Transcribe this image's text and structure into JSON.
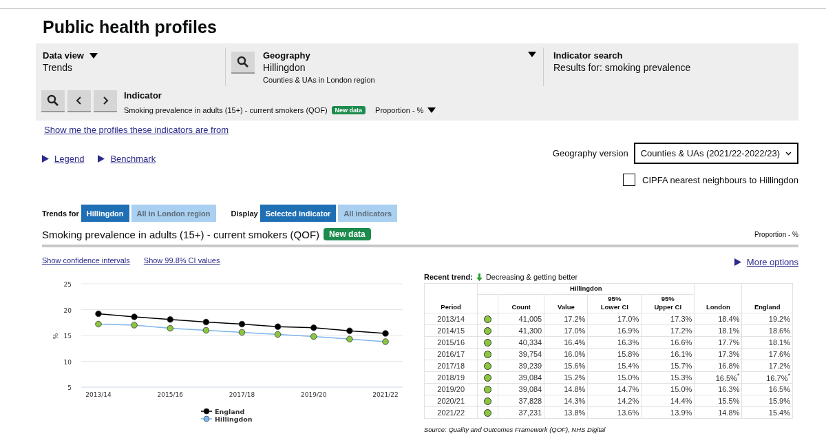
{
  "page_title": "Public health profiles",
  "panel": {
    "data_view": {
      "label": "Data view",
      "value": "Trends"
    },
    "geography": {
      "label": "Geography",
      "value": "Hillingdon",
      "sub": "Counties & UAs in London region"
    },
    "indicator_search": {
      "label": "Indicator search",
      "value": "Results for: smoking prevalence"
    },
    "indicator": {
      "label": "Indicator",
      "value": "Smoking prevalence in adults (15+) - current smokers (QOF)",
      "badge": "New data",
      "unit": "Proportion - %"
    }
  },
  "profiles_link": "Show me the profiles these indicators are from",
  "expanders": [
    {
      "label": "Legend",
      "expanded": false
    },
    {
      "label": "Benchmark",
      "expanded": false
    }
  ],
  "geography_version": {
    "label": "Geography version",
    "value": "Counties & UAs (2021/22-2022/23)"
  },
  "cipfa": {
    "label": "CIPFA nearest neighbours to Hillingdon",
    "checked": false
  },
  "toggle_groups": [
    {
      "label": "Trends for",
      "options": [
        {
          "label": "Hillingdon",
          "selected": true
        },
        {
          "label": "All in London region",
          "selected": false
        }
      ]
    },
    {
      "label": "Display",
      "options": [
        {
          "label": "Selected indicator",
          "selected": true
        },
        {
          "label": "All indicators",
          "selected": false
        }
      ]
    }
  ],
  "indicator_title": {
    "text": "Smoking prevalence in adults (15+) - current smokers (QOF)",
    "badge": "New data",
    "unit": "Proportion - %"
  },
  "links": [
    "Show confidence intervals",
    "Show 99.8% CI values"
  ],
  "more_options": "More options",
  "chart_data": {
    "type": "line",
    "ylabel": "%",
    "categories": [
      "2013/14",
      null,
      "2015/16",
      null,
      "2017/18",
      null,
      "2019/20",
      null,
      "2021/22"
    ],
    "series": [
      {
        "name": "England",
        "color": "#000000",
        "marker": "circle",
        "values": [
          19.2,
          18.6,
          18.1,
          17.6,
          17.2,
          16.7,
          16.5,
          15.9,
          15.4
        ]
      },
      {
        "name": "Hillingdon",
        "color": "#7cb5ec",
        "marker": "circle",
        "values": [
          17.2,
          17.0,
          16.4,
          16.0,
          15.6,
          15.2,
          14.8,
          14.3,
          13.8
        ]
      }
    ],
    "ylim": [
      5,
      25
    ],
    "yticks": [
      5,
      10,
      15,
      20,
      25
    ],
    "grid": true,
    "legend": true
  },
  "recent_trend": {
    "label": "Recent trend:",
    "text": "Decreasing & getting better"
  },
  "table": {
    "group_header": "Hillingdon",
    "columns": [
      "Period",
      "Count",
      "Value",
      "95%\nLower CI",
      "95%\nUpper CI",
      "London",
      "England"
    ],
    "rows": [
      {
        "period": "2013/14",
        "color": "#8cc63f",
        "count": "41,005",
        "value": "17.2%",
        "lower": "17.0%",
        "upper": "17.3%",
        "london": "18.4%",
        "england": "19.2%"
      },
      {
        "period": "2014/15",
        "color": "#8cc63f",
        "count": "41,300",
        "value": "17.0%",
        "lower": "16.9%",
        "upper": "17.2%",
        "london": "18.1%",
        "england": "18.6%"
      },
      {
        "period": "2015/16",
        "color": "#8cc63f",
        "count": "40,334",
        "value": "16.4%",
        "lower": "16.3%",
        "upper": "16.6%",
        "london": "17.7%",
        "england": "18.1%"
      },
      {
        "period": "2016/17",
        "color": "#8cc63f",
        "count": "39,754",
        "value": "16.0%",
        "lower": "15.8%",
        "upper": "16.1%",
        "london": "17.3%",
        "england": "17.6%"
      },
      {
        "period": "2017/18",
        "color": "#8cc63f",
        "count": "39,239",
        "value": "15.6%",
        "lower": "15.4%",
        "upper": "15.7%",
        "london": "16.8%",
        "england": "17.2%"
      },
      {
        "period": "2018/19",
        "color": "#8cc63f",
        "count": "39,084",
        "value": "15.2%",
        "lower": "15.0%",
        "upper": "15.3%",
        "london": "16.5%$^{*}$",
        "england": "16.7%$^{*}$"
      },
      {
        "period": "2019/20",
        "color": "#8cc63f",
        "count": "39,084",
        "value": "14.8%",
        "lower": "14.7%",
        "upper": "15.0%",
        "london": "16.3%",
        "england": "16.5%"
      },
      {
        "period": "2020/21",
        "color": "#8cc63f",
        "count": "37,828",
        "value": "14.3%",
        "lower": "14.2%",
        "upper": "14.4%",
        "london": "15.5%",
        "england": "15.9%"
      },
      {
        "period": "2021/22",
        "color": "#8cc63f",
        "count": "37,231",
        "value": "13.8%",
        "lower": "13.6%",
        "upper": "13.9%",
        "london": "14.8%",
        "england": "15.4%"
      }
    ]
  },
  "source": "Source: Quality and Outcomes Framework (QOF), NHS Digital"
}
